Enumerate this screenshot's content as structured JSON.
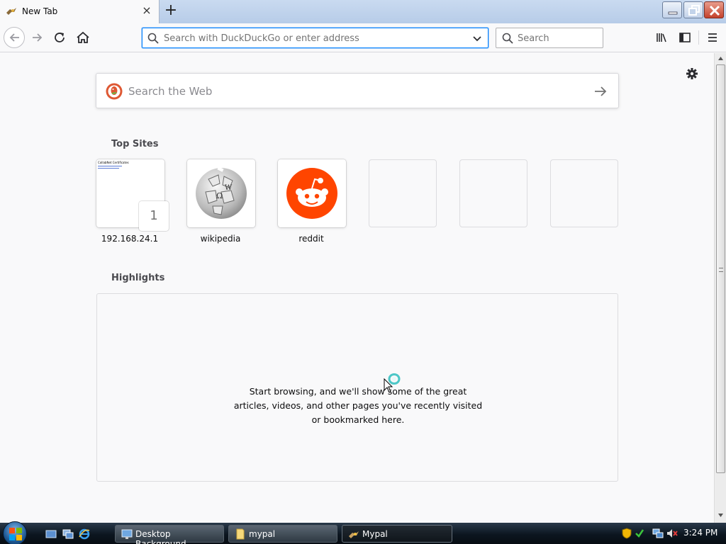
{
  "tab": {
    "title": "New Tab",
    "close_glyph": "×",
    "new_tab_glyph": "+"
  },
  "window_controls": [
    "minimize-icon",
    "restore-icon",
    "close-icon"
  ],
  "navbar": {
    "url_placeholder": "Search with DuckDuckGo or enter address",
    "search_placeholder": "Search"
  },
  "newtab": {
    "web_search_placeholder": "Search the Web",
    "top_sites_title": "Top Sites",
    "top_sites": [
      {
        "label": "192.168.24.1",
        "badge": "1",
        "shot_title": "CollabNet Certificates"
      },
      {
        "label": "wikipedia"
      },
      {
        "label": "reddit"
      },
      {
        "label": ""
      },
      {
        "label": ""
      },
      {
        "label": ""
      }
    ],
    "highlights_title": "Highlights",
    "highlights_message": "Start browsing, and we'll show some of the great articles, videos, and other pages you've recently visited or bookmarked here."
  },
  "colors": {
    "accent": "#0a84ff",
    "reddit": "#ff4500",
    "duckduckgo": "#de5833"
  },
  "taskbar": {
    "tasks": [
      {
        "label": "Desktop Background",
        "icon": "monitor-icon"
      },
      {
        "label": "mypal",
        "icon": "folder-icon"
      },
      {
        "label": "Mypal",
        "icon": "mypal-icon"
      }
    ],
    "clock": "3:24 PM"
  }
}
